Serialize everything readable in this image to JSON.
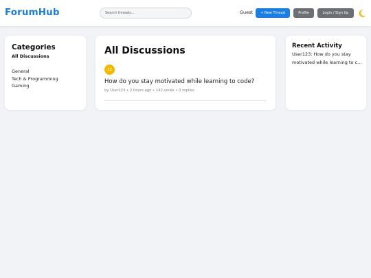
{
  "header": {
    "logo": "ForumHub",
    "search_placeholder": "Search threads...",
    "user_label": "Guest",
    "new_thread_label": "+ New Thread",
    "profile_label": "Profile",
    "login_label": "Login / Sign Up",
    "theme_icon": "moon-icon"
  },
  "sidebar": {
    "title": "Categories",
    "active": "All Discussions",
    "items": [
      "General",
      "Tech & Programming",
      "Gaming"
    ]
  },
  "main": {
    "title": "All Discussions",
    "threads": [
      {
        "badge": "12",
        "title": "How do you stay motivated while learning to code?",
        "meta": "by User123 • 2 hours ago • 142 views • 0 replies"
      }
    ]
  },
  "activity": {
    "title": "Recent Activity",
    "text": "User123: How do you stay motivated while learning to c..."
  },
  "colors": {
    "brand": "#1d7fd6",
    "primary_button": "#1a7fe0",
    "secondary_button": "#6c7075",
    "badge": "#f5b800",
    "background": "#f1f3f6"
  }
}
